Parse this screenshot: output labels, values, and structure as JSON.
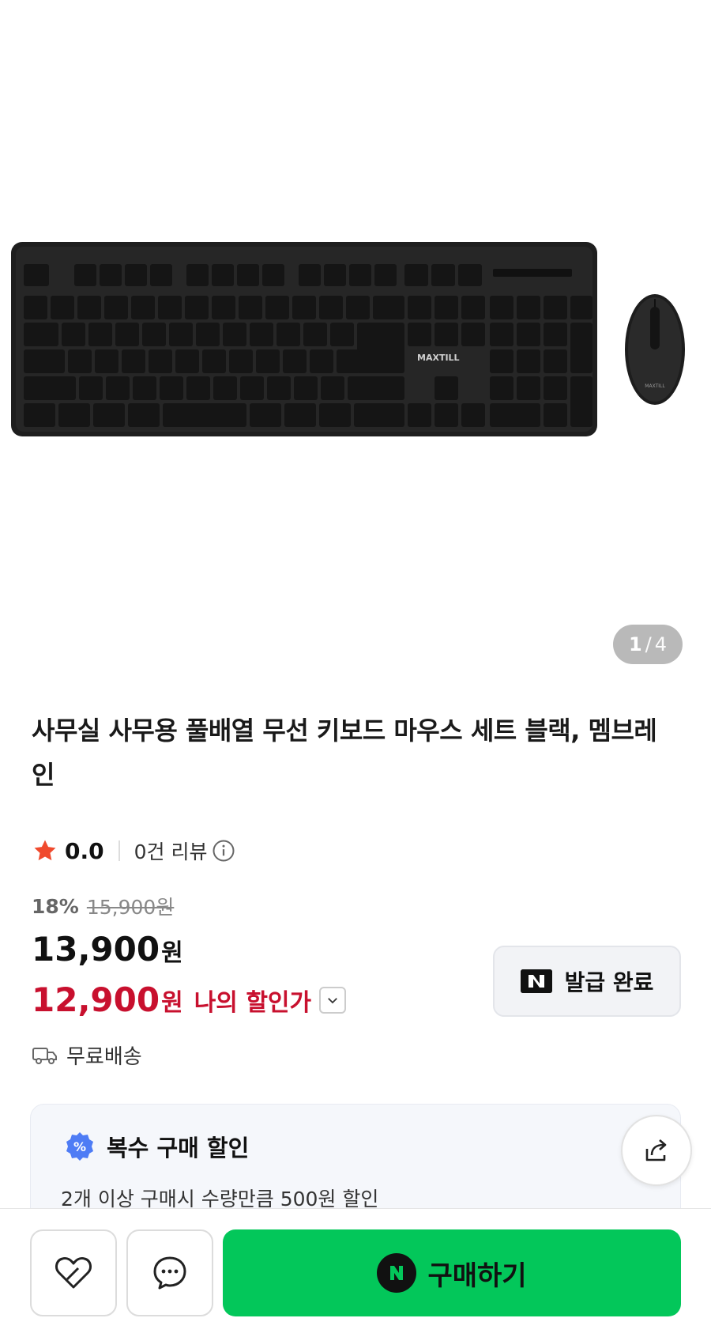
{
  "gallery": {
    "current": "1",
    "separator": "/",
    "total": "4",
    "brand_on_keyboard": "MAXTILL"
  },
  "product": {
    "title": "사무실 사무용 풀배열 무선 키보드 마우스 세트 블랙, 멤브레인"
  },
  "rating": {
    "score": "0.0",
    "review_count_text": "0건 리뷰"
  },
  "price": {
    "discount_rate": "18%",
    "original_price": "15,900원",
    "sale_price": "13,900",
    "sale_unit": "원",
    "my_price": "12,900",
    "my_price_unit": "원",
    "my_price_label": "나의 할인가"
  },
  "coupon": {
    "label": "발급 완료"
  },
  "shipping": {
    "label": "무료배송"
  },
  "bulk_discount": {
    "title": "복수 구매 할인",
    "description": "2개 이상 구매시 수량만큼 500원 할인"
  },
  "bottom_bar": {
    "buy_label": "구매하기"
  },
  "colors": {
    "accent_green": "#03c75a",
    "my_price_red": "#c8102e",
    "star_red": "#f04a2d"
  },
  "icons": [
    "star-icon",
    "info-icon",
    "chevron-down-icon",
    "naver-n-icon",
    "truck-icon",
    "percent-icon",
    "share-icon",
    "heart-icon",
    "chat-icon"
  ]
}
